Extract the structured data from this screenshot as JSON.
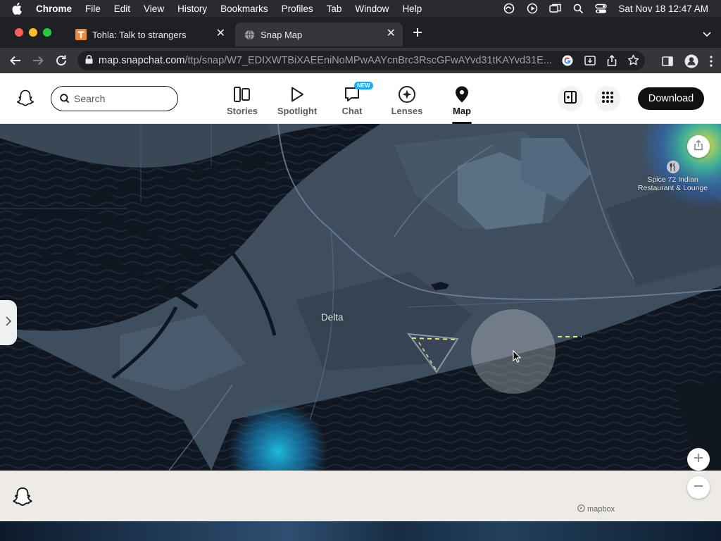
{
  "menubar": {
    "app_name": "Chrome",
    "items": [
      "File",
      "Edit",
      "View",
      "History",
      "Bookmarks",
      "Profiles",
      "Tab",
      "Window",
      "Help"
    ],
    "clock": "Sat Nov 18  12:47 AM"
  },
  "tabs": [
    {
      "title": "Tohla: Talk to strangers",
      "favicon": "tohla-t-icon",
      "active": false
    },
    {
      "title": "Snap Map",
      "favicon": "globe-icon",
      "active": true
    }
  ],
  "address_bar": {
    "domain": "map.snapchat.com",
    "path": "/ttp/snap/W7_EDIXWTBiXAEEniNoMPwAAYcnBrc3RscGFwAYvd31tKAYvd31E..."
  },
  "snap_header": {
    "search_placeholder": "Search",
    "nav": [
      {
        "label": "Stories",
        "icon": "stories-icon",
        "active": false
      },
      {
        "label": "Spotlight",
        "icon": "spotlight-play-icon",
        "active": false
      },
      {
        "label": "Chat",
        "icon": "chat-bubble-icon",
        "active": false,
        "badge": "NEW"
      },
      {
        "label": "Lenses",
        "icon": "lenses-sparkle-icon",
        "active": false
      },
      {
        "label": "Map",
        "icon": "map-pin-icon",
        "active": true
      }
    ],
    "download_label": "Download"
  },
  "map": {
    "place_label": "Delta",
    "poi_name": "Spice 72 Indian Restaurant & Lounge",
    "poi_icon": "restaurant-fork-knife-icon",
    "attribution": "mapbox"
  },
  "colors": {
    "snap_yellow": "#fffc00",
    "map_land": "#3c4a5c",
    "map_water": "#10161f",
    "heat_cyan": "#1fc3e8"
  }
}
